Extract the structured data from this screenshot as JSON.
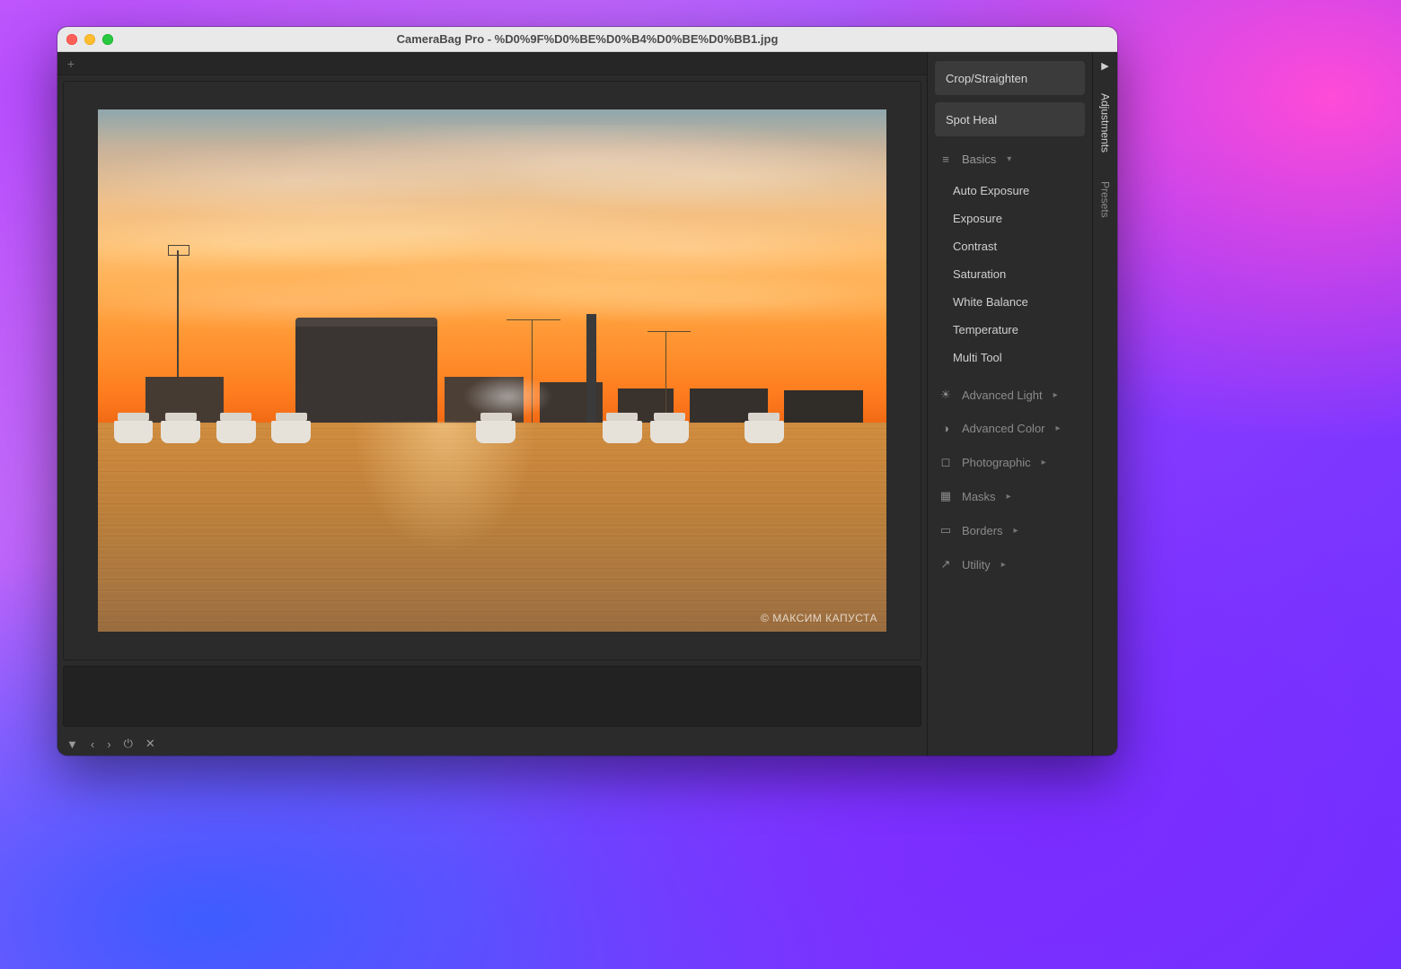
{
  "window": {
    "title": "CameraBag Pro - %D0%9F%D0%BE%D0%B4%D0%BE%D0%BB1.jpg"
  },
  "toolbar": {
    "add_tab_glyph": "+"
  },
  "image": {
    "watermark": "© МАКСИМ КАПУСТА"
  },
  "bottom": {
    "menu_glyph": "▼",
    "prev_glyph": "‹",
    "next_glyph": "›",
    "power_glyph": "⏻",
    "close_glyph": "✕"
  },
  "side": {
    "crop_btn": "Crop/Straighten",
    "spotheal_btn": "Spot Heal",
    "basics": {
      "label": "Basics",
      "items": {
        "auto_exposure": "Auto Exposure",
        "exposure": "Exposure",
        "contrast": "Contrast",
        "saturation": "Saturation",
        "white_balance": "White Balance",
        "temperature": "Temperature",
        "multi_tool": "Multi Tool"
      }
    },
    "advanced_light": "Advanced Light",
    "advanced_color": "Advanced Color",
    "photographic": "Photographic",
    "masks": "Masks",
    "borders": "Borders",
    "utility": "Utility"
  },
  "vstrip": {
    "toggle_glyph": "▶",
    "adjustments": "Adjustments",
    "presets": "Presets"
  },
  "icons": {
    "sliders": "≡",
    "sun": "☀",
    "palette": "◑",
    "camera": "◻",
    "masks": "▦",
    "borders": "▭",
    "utility": "↗",
    "chev_down": "▾",
    "chev_right": "▸"
  }
}
